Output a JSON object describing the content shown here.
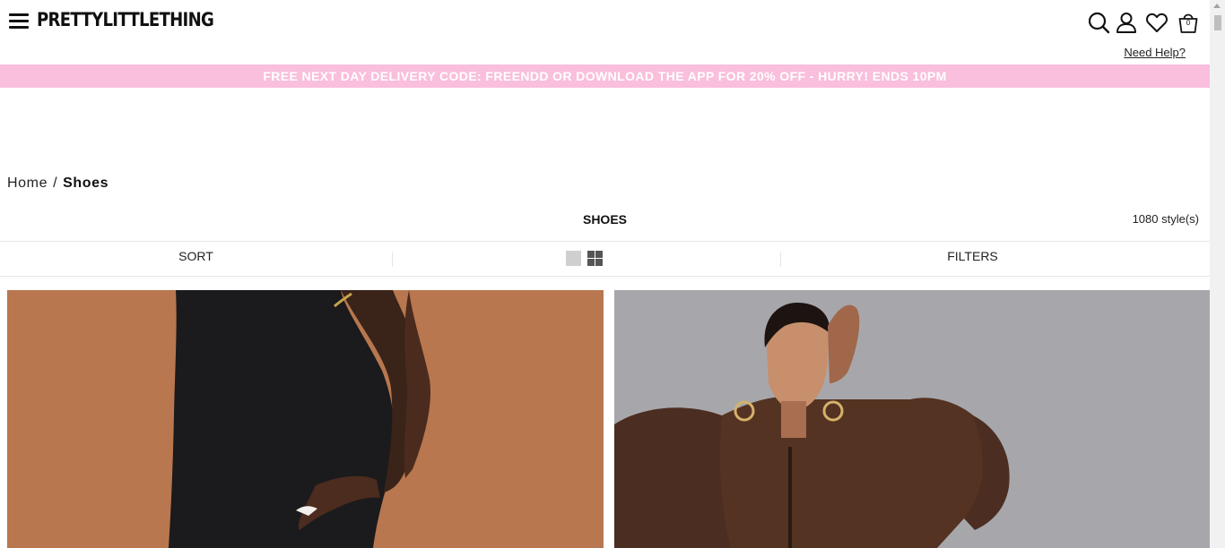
{
  "header": {
    "logo": "PRETTYLITTLETHING",
    "cart_count": "0",
    "help_link": "Need Help?",
    "icons": [
      "menu-icon",
      "search-icon",
      "account-icon",
      "heart-icon",
      "bag-icon"
    ]
  },
  "promo_banner": {
    "text": "FREE NEXT DAY DELIVERY CODE: FREENDD OR DOWNLOAD THE APP FOR 20% OFF - HURRY! ENDS 10PM",
    "background": "#f9bfdc"
  },
  "breadcrumb": {
    "home": "Home",
    "separator": "/",
    "current": "Shoes"
  },
  "listing": {
    "title": "SHOES",
    "style_count": "1080 style(s)"
  },
  "toolbar": {
    "sort_label": "SORT",
    "filters_label": "FILTERS"
  },
  "products": [
    {
      "image": "model-black-ribbed-dress",
      "background": "#b8774f"
    },
    {
      "image": "model-brown-borg-jacket",
      "background": "#a7a7ab"
    }
  ]
}
